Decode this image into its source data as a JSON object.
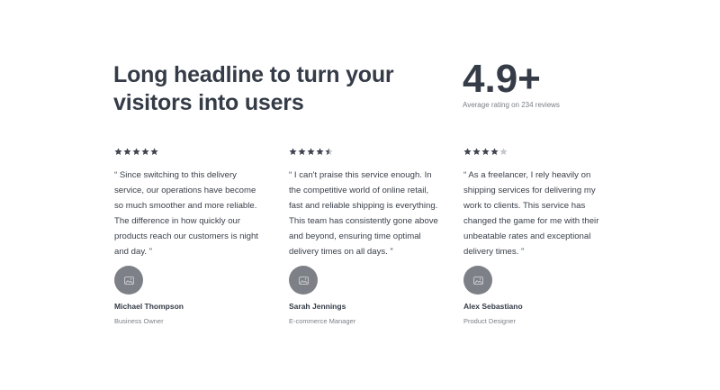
{
  "headline": "Long headline to turn your visitors into users",
  "rating": {
    "value": "4.9+",
    "caption": "Average rating on 234 reviews"
  },
  "colors": {
    "text_dark": "#353c47",
    "text_muted": "#7a7f87",
    "star_filled": "#3e4450",
    "star_empty": "#c4c7cc",
    "avatar_bg": "#7d8087"
  },
  "testimonials": [
    {
      "stars": 5,
      "quote": "“ Since switching to this delivery\nservice, our operations have become\nso much smoother and more reliable.\nThe difference in how quickly our\nproducts reach our customers is night\nand day. ”",
      "name": "Michael Thompson",
      "role": "Business Owner",
      "avatar_icon": "image-placeholder-icon"
    },
    {
      "stars": 4.5,
      "quote": "“ I can't praise this service enough. In\nthe competitive world of online retail,\nfast and reliable shipping is everything.\nThis team has consistently gone above\nand beyond, ensuring time optimal\ndelivery times on all days. ”",
      "name": "Sarah Jennings",
      "role": "E-commerce Manager",
      "avatar_icon": "image-placeholder-icon"
    },
    {
      "stars": 4,
      "quote": "“ As a freelancer, I rely heavily on\nshipping services for delivering my\nwork to clients. This service has\nchanged the game for me with their\nunbeatable rates and exceptional\ndelivery times.  ”",
      "name": "Alex Sebastiano",
      "role": "Product Designer",
      "avatar_icon": "image-placeholder-icon"
    }
  ]
}
